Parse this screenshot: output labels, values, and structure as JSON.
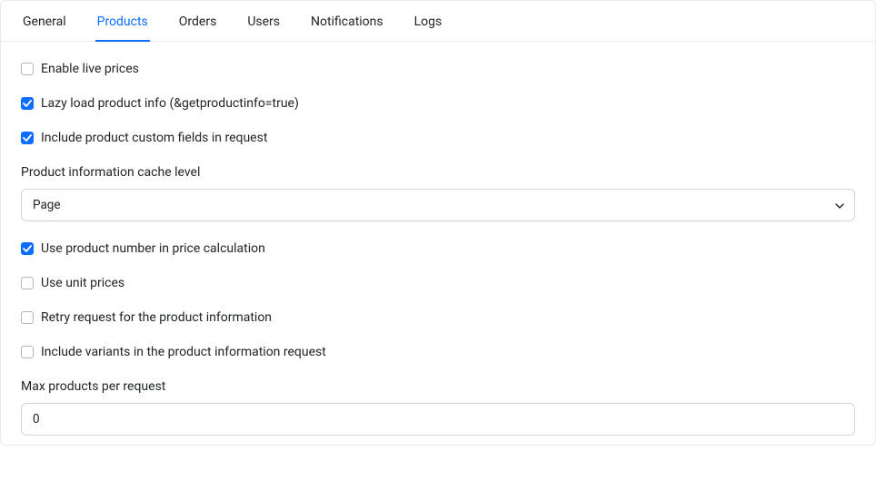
{
  "tabs": {
    "general": "General",
    "products": "Products",
    "orders": "Orders",
    "users": "Users",
    "notifications": "Notifications",
    "logs": "Logs",
    "active": "products"
  },
  "settings": {
    "enable_live_prices": {
      "label": "Enable live prices",
      "checked": false
    },
    "lazy_load": {
      "label": "Lazy load product info (&getproductinfo=true)",
      "checked": true
    },
    "include_custom_fields": {
      "label": "Include product custom fields in request",
      "checked": true
    },
    "cache_level": {
      "label": "Product information cache level",
      "value": "Page"
    },
    "use_product_number": {
      "label": "Use product number in price calculation",
      "checked": true
    },
    "use_unit_prices": {
      "label": "Use unit prices",
      "checked": false
    },
    "retry_request": {
      "label": "Retry request for the product information",
      "checked": false
    },
    "include_variants": {
      "label": "Include variants in the product information request",
      "checked": false
    },
    "max_products": {
      "label": "Max products per request",
      "value": "0"
    }
  }
}
